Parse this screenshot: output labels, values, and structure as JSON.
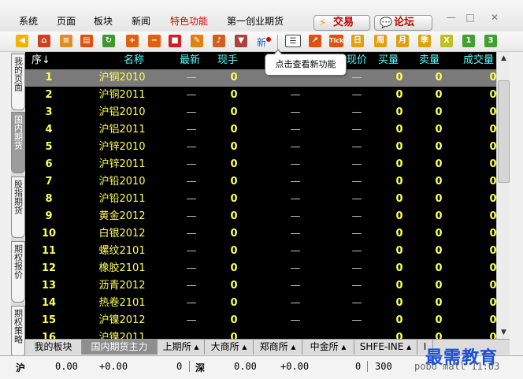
{
  "menu": {
    "items": [
      "系统",
      "页面",
      "板块",
      "新闻",
      "特色功能",
      "第一创业期货"
    ],
    "highlight_index": 4,
    "trade_button": "交易",
    "forum_button": "论坛",
    "window_controls": [
      "minimize-icon",
      "restore-icon",
      "close-icon"
    ]
  },
  "toolbar": {
    "icons": [
      "back-arrow-icon",
      "home-icon",
      "notebook-icon",
      "news-icon",
      "refresh-icon",
      "zoom-in-icon",
      "zoom-out-icon",
      "color-icon",
      "pen-icon",
      "bell-icon",
      "filter-icon"
    ],
    "new_label": "新",
    "period_labels": [
      "日",
      "周",
      "月",
      "季",
      "X",
      "1",
      "3"
    ],
    "tick_label": "Tick"
  },
  "tooltip": "点击查看新功能",
  "side_tabs": [
    "我的页面",
    "国内期货",
    "股指期货",
    "期权报价",
    "期权策略"
  ],
  "active_side_tab": 1,
  "table": {
    "headers": [
      "序",
      "名称",
      "最新",
      "现手",
      "现价",
      "买量",
      "卖量",
      "成交量"
    ],
    "sort_indicator": "↓",
    "rows": [
      {
        "idx": "1",
        "name": "沪铜2010",
        "latest": "—",
        "hand": "0",
        "cur": "",
        "now": "—",
        "buy": "0",
        "sell": "0",
        "vol": "0"
      },
      {
        "idx": "2",
        "name": "沪铜2011",
        "latest": "—",
        "hand": "0",
        "cur": "—",
        "now": "—",
        "buy": "0",
        "sell": "0",
        "vol": "0"
      },
      {
        "idx": "3",
        "name": "沪铝2010",
        "latest": "—",
        "hand": "0",
        "cur": "—",
        "now": "—",
        "buy": "0",
        "sell": "0",
        "vol": "0"
      },
      {
        "idx": "4",
        "name": "沪铝2011",
        "latest": "—",
        "hand": "0",
        "cur": "—",
        "now": "—",
        "buy": "0",
        "sell": "0",
        "vol": "0"
      },
      {
        "idx": "5",
        "name": "沪锌2010",
        "latest": "—",
        "hand": "0",
        "cur": "—",
        "now": "—",
        "buy": "0",
        "sell": "0",
        "vol": "0"
      },
      {
        "idx": "6",
        "name": "沪锌2011",
        "latest": "—",
        "hand": "0",
        "cur": "—",
        "now": "—",
        "buy": "0",
        "sell": "0",
        "vol": "0"
      },
      {
        "idx": "7",
        "name": "沪铅2010",
        "latest": "—",
        "hand": "0",
        "cur": "—",
        "now": "—",
        "buy": "0",
        "sell": "0",
        "vol": "0"
      },
      {
        "idx": "8",
        "name": "沪铅2011",
        "latest": "—",
        "hand": "0",
        "cur": "—",
        "now": "—",
        "buy": "0",
        "sell": "0",
        "vol": "0"
      },
      {
        "idx": "9",
        "name": "黄金2012",
        "latest": "—",
        "hand": "0",
        "cur": "—",
        "now": "—",
        "buy": "0",
        "sell": "0",
        "vol": "0"
      },
      {
        "idx": "10",
        "name": "白银2012",
        "latest": "—",
        "hand": "0",
        "cur": "—",
        "now": "—",
        "buy": "0",
        "sell": "0",
        "vol": "0"
      },
      {
        "idx": "11",
        "name": "螺纹2101",
        "latest": "—",
        "hand": "0",
        "cur": "—",
        "now": "—",
        "buy": "0",
        "sell": "0",
        "vol": "0"
      },
      {
        "idx": "12",
        "name": "橡胶2101",
        "latest": "—",
        "hand": "0",
        "cur": "—",
        "now": "—",
        "buy": "0",
        "sell": "0",
        "vol": "0"
      },
      {
        "idx": "13",
        "name": "沥青2012",
        "latest": "—",
        "hand": "0",
        "cur": "—",
        "now": "—",
        "buy": "0",
        "sell": "0",
        "vol": "0"
      },
      {
        "idx": "14",
        "name": "热卷2101",
        "latest": "—",
        "hand": "0",
        "cur": "—",
        "now": "—",
        "buy": "0",
        "sell": "0",
        "vol": "0"
      },
      {
        "idx": "15",
        "name": "沪镍2012",
        "latest": "—",
        "hand": "0",
        "cur": "—",
        "now": "—",
        "buy": "0",
        "sell": "0",
        "vol": "0"
      },
      {
        "idx": "16",
        "name": "沪镍2011",
        "latest": "",
        "hand": "0",
        "cur": "",
        "now": "",
        "buy": "0",
        "sell": "0",
        "vol": "0"
      }
    ],
    "selected_row": 0
  },
  "bottom_tabs": [
    {
      "label": "我的板块",
      "active": false
    },
    {
      "label": "国内期货主力",
      "active": true
    },
    {
      "label": "上期所 ▴",
      "active": false
    },
    {
      "label": "大商所 ▴",
      "active": false
    },
    {
      "label": "郑商所 ▴",
      "active": false
    },
    {
      "label": "中金所 ▴",
      "active": false
    },
    {
      "label": "SHFE-INE ▴",
      "active": false
    },
    {
      "label": "I",
      "active": false
    }
  ],
  "status": {
    "sh_label": "沪",
    "sh_value": "0.00",
    "sh_change": "+0.00",
    "sh_volume": "0",
    "sz_label": "深",
    "sz_value": "0.00",
    "sz_change": "+0.00",
    "sz_volume": "0",
    "extra": "300",
    "tail": "pobo mall 11:03"
  },
  "watermark": "最需教育",
  "colors": {
    "grid_bg": "#000000",
    "yellow": "#ffff54",
    "header_cyan": "#55ffff",
    "accent_red": "#e00000"
  }
}
